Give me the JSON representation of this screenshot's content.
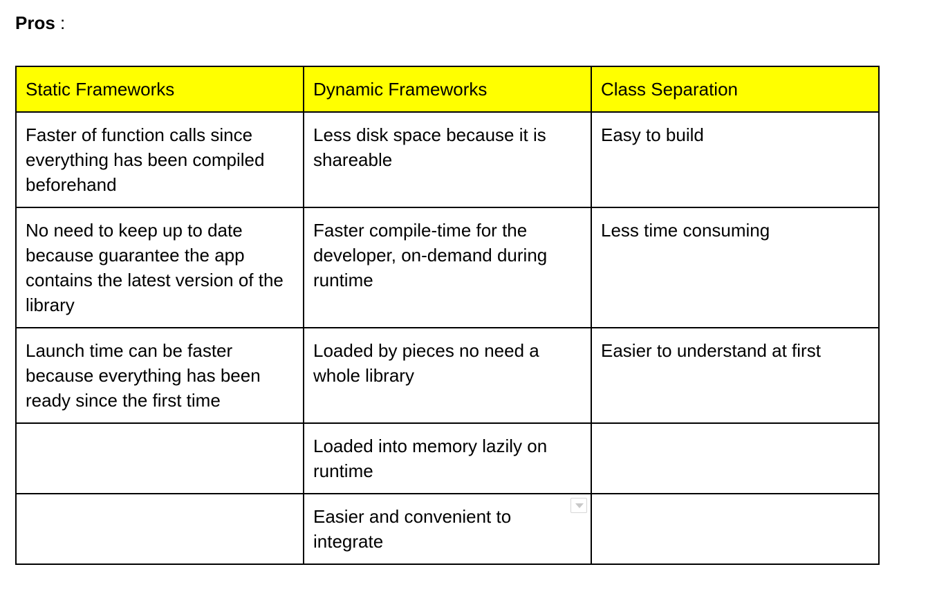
{
  "heading": {
    "label": "Pros",
    "suffix": " :"
  },
  "table": {
    "header_color": "#ffff00",
    "columns": [
      "Static Frameworks",
      "Dynamic Frameworks",
      "Class Separation"
    ],
    "rows": [
      [
        "Faster of function calls since everything has been compiled beforehand",
        "Less disk space because it is shareable",
        "Easy to build"
      ],
      [
        "No need to keep up to date because guarantee the app contains the latest version of the library",
        "Faster compile-time for the developer, on-demand during runtime",
        "Less time consuming"
      ],
      [
        "Launch time can be faster because everything has been ready since the first time",
        "Loaded by pieces no need a whole library",
        "Easier to understand at first"
      ],
      [
        "",
        "Loaded into memory lazily on runtime",
        ""
      ],
      [
        "",
        "Easier and convenient to integrate",
        ""
      ]
    ],
    "cell_icon": "dropdown-arrow-icon"
  }
}
